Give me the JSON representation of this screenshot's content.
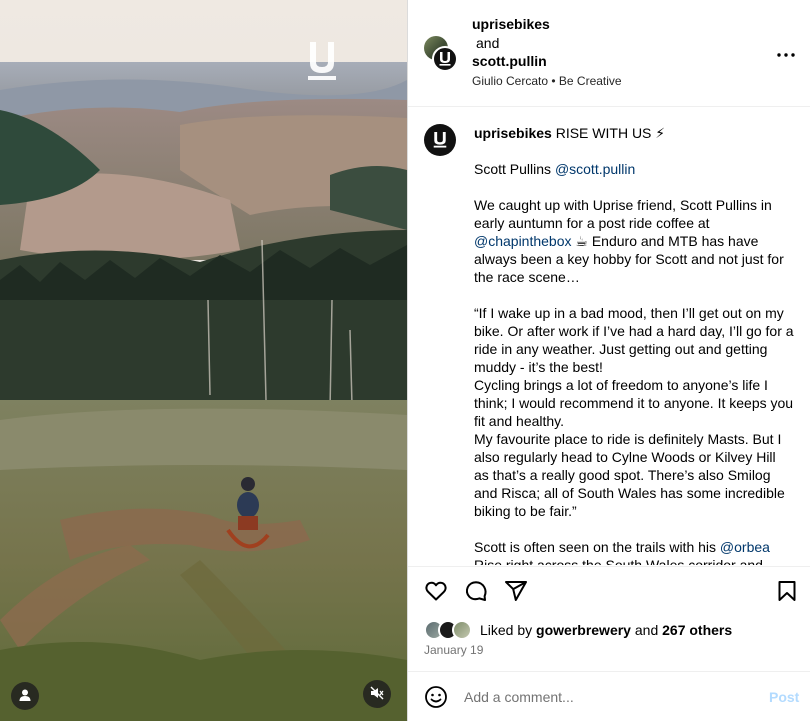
{
  "header": {
    "user1": "uprisebikes",
    "and": "and",
    "user2": "scott.pullin",
    "meta": "Giulio Cercato • Be Creative",
    "more_icon": "more-horizontal-icon"
  },
  "caption": {
    "username": "uprisebikes",
    "title": "RISE WITH US ⚡",
    "line_scott": "Scott Pullins ",
    "mention_scott": "@scott.pullin",
    "para1_a": "We caught up with Uprise friend, Scott Pullins in early auntumn for a post ride coffee at ",
    "mention_chap": "@chapinthebox",
    "para1_b": " ☕ Enduro and MTB has have always been a key hobby for Scott and not just for the race scene…",
    "quote1": "“If I wake up in a bad mood, then I’ll get out on my bike. Or after work if I’ve had a hard day, I’ll go for a ride in any weather. Just getting out and getting muddy - it’s the best!",
    "quote2": "Cycling brings a lot of freedom to anyone’s life I think; I would recommend it to anyone. It keeps you fit and healthy.",
    "quote3": "My favourite place to ride is definitely Masts. But I also regularly head to Cylne Woods or Kilvey Hill as that’s a really good spot. There’s also Smilog and Risca; all of South Wales has some incredible biking to be fair.”",
    "para3_a": "Scott is often seen on the trails with his ",
    "mention_orbea": "@orbea",
    "para3_b": " Rise right across the South Wales corridor and"
  },
  "actions": {
    "like_icon": "heart-icon",
    "comment_icon": "comment-icon",
    "share_icon": "send-icon",
    "save_icon": "bookmark-icon"
  },
  "likes": {
    "prefix": "Liked by ",
    "user": "gowerbrewery",
    "middle": " and ",
    "count": "267 others"
  },
  "date": "January 19",
  "comment": {
    "placeholder": "Add a comment...",
    "post_label": "Post",
    "emoji_icon": "emoji-icon"
  },
  "media": {
    "logo_icon": "uprise-logo-icon",
    "user_icon": "user-tag-icon",
    "mute_icon": "muted-speaker-icon"
  }
}
